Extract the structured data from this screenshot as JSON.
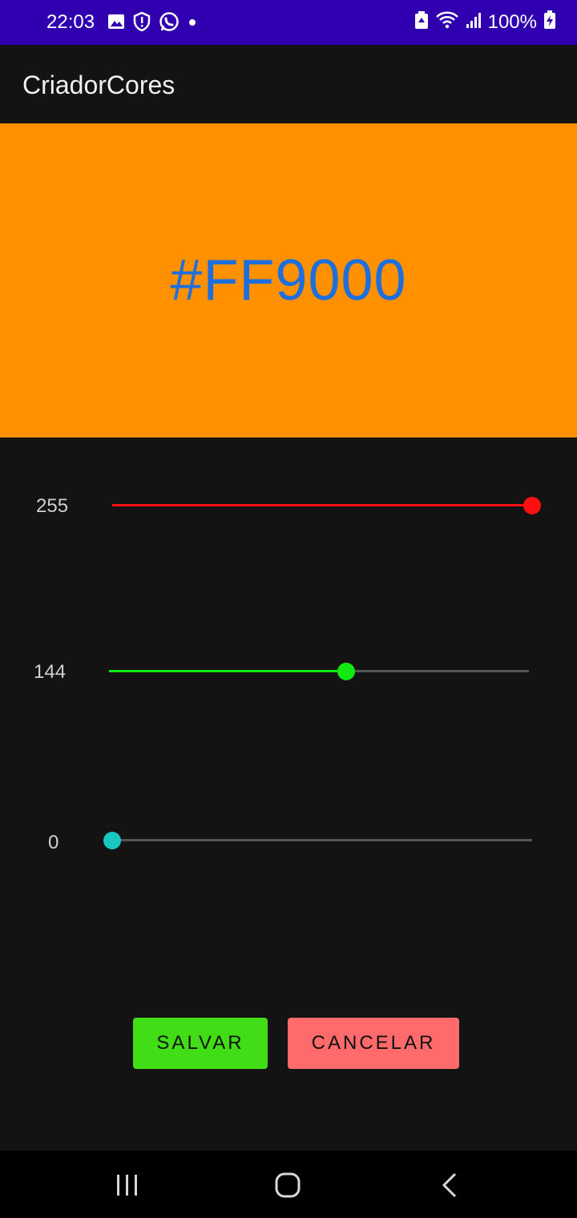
{
  "status_bar": {
    "time": "22:03",
    "battery_text": "100%",
    "background": "#3000b0",
    "icons": [
      "image-icon",
      "shield-icon",
      "whatsapp-icon",
      "dot-icon",
      "battery-saver-icon",
      "wifi-icon",
      "signal-icon",
      "battery-charging-icon"
    ]
  },
  "app_bar": {
    "title": "CriadorCores"
  },
  "preview": {
    "hex": "#FF9000",
    "color": "#FF9000"
  },
  "sliders": [
    {
      "name": "red",
      "value": 255,
      "value_label": "255",
      "max": 255,
      "color": "#ff1010"
    },
    {
      "name": "green",
      "value": 144,
      "value_label": "144",
      "max": 255,
      "color": "#10e810"
    },
    {
      "name": "blue",
      "value": 0,
      "value_label": "0",
      "max": 255,
      "color": "#18c8c0"
    }
  ],
  "buttons": {
    "save": {
      "label": "SALVAR",
      "color": "#41dd16"
    },
    "cancel": {
      "label": "CANCELAR",
      "color": "#ff6a6a"
    }
  },
  "nav_bar": {
    "icons": [
      "recents-icon",
      "home-icon",
      "back-icon"
    ]
  }
}
